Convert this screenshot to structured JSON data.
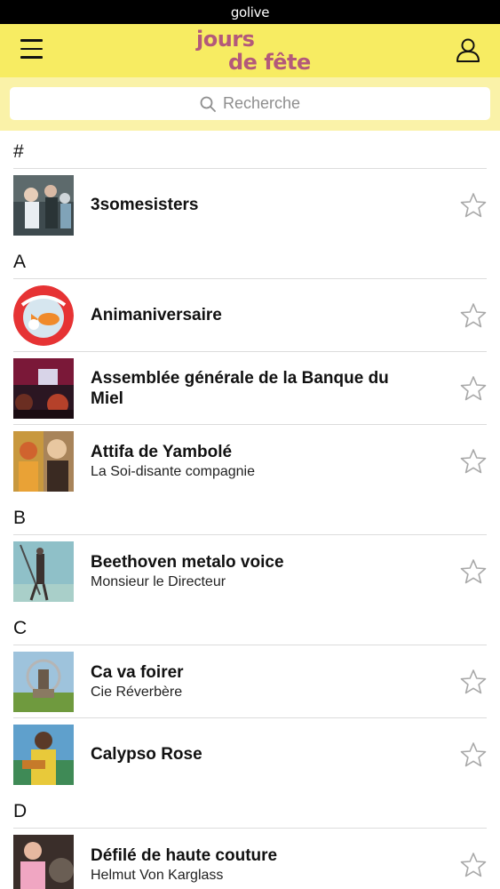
{
  "status_bar": {
    "carrier": "golive"
  },
  "header": {
    "logo_line1": "jours",
    "logo_line2": "de fête",
    "menu_icon": "hamburger-icon",
    "user_icon": "user-icon"
  },
  "search": {
    "placeholder": "Recherche",
    "icon": "search-icon"
  },
  "sections": [
    {
      "letter": "#",
      "items": [
        {
          "title": "3somesisters",
          "subtitle": ""
        }
      ]
    },
    {
      "letter": "A",
      "items": [
        {
          "title": "Animaniversaire",
          "subtitle": ""
        },
        {
          "title": "Assemblée générale de la Banque du Miel",
          "subtitle": ""
        },
        {
          "title": "Attifa de Yambolé",
          "subtitle": "La Soi-disante compagnie"
        }
      ]
    },
    {
      "letter": "B",
      "items": [
        {
          "title": "Beethoven metalo voice",
          "subtitle": "Monsieur le Directeur"
        }
      ]
    },
    {
      "letter": "C",
      "items": [
        {
          "title": "Ca va foirer",
          "subtitle": "Cie Réverbère"
        },
        {
          "title": "Calypso Rose",
          "subtitle": ""
        }
      ]
    },
    {
      "letter": "D",
      "items": [
        {
          "title": "Défilé de haute couture",
          "subtitle": "Helmut Von Karglass"
        }
      ]
    }
  ],
  "colors": {
    "header_bg": "#f7ec62",
    "search_bg": "#faf2a8",
    "logo": "#b3597a",
    "star": "#a8a8a8"
  }
}
